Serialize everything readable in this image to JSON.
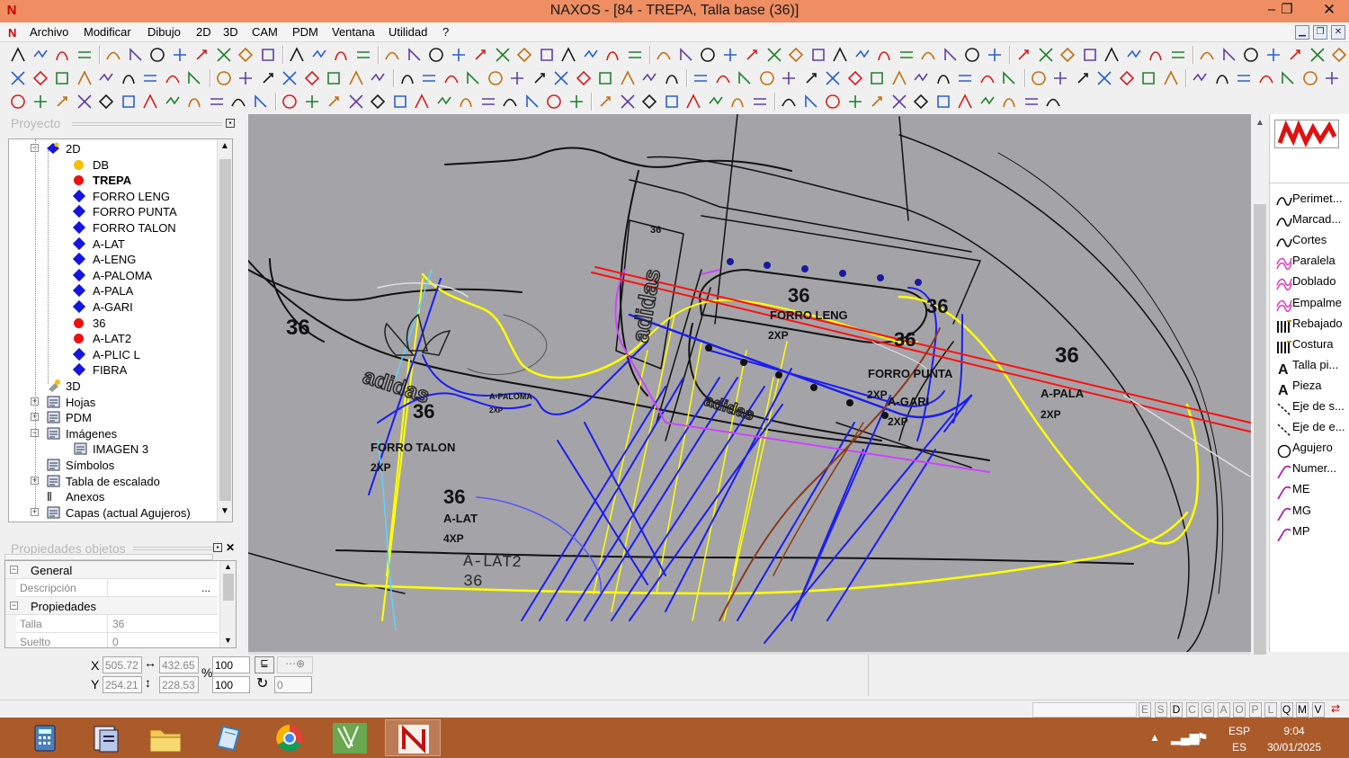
{
  "window": {
    "title": "NAXOS - [84 - TREPA, Talla base (36)]",
    "minimize": "‒",
    "restore": "❐",
    "close": "✕"
  },
  "menu": [
    "Archivo",
    "Modificar",
    "Dibujo",
    "2D",
    "3D",
    "CAM",
    "PDM",
    "Ventana",
    "Utilidad",
    "?"
  ],
  "project_panel": {
    "title": "Proyecto",
    "tree": [
      {
        "label": "2D",
        "kind": "folder2d",
        "level": 1,
        "expand": "−"
      },
      {
        "label": "DB",
        "kind": "dot-yellow",
        "level": 2
      },
      {
        "label": "TREPA",
        "kind": "dot-red",
        "level": 2,
        "bold": true
      },
      {
        "label": "FORRO LENG",
        "kind": "diamond",
        "level": 2
      },
      {
        "label": "FORRO PUNTA",
        "kind": "diamond",
        "level": 2
      },
      {
        "label": "FORRO TALON",
        "kind": "diamond",
        "level": 2
      },
      {
        "label": "A-LAT",
        "kind": "diamond",
        "level": 2
      },
      {
        "label": "A-LENG",
        "kind": "diamond",
        "level": 2
      },
      {
        "label": "A-PALOMA",
        "kind": "diamond",
        "level": 2
      },
      {
        "label": "A-PALA",
        "kind": "diamond",
        "level": 2
      },
      {
        "label": "A-GARI",
        "kind": "diamond",
        "level": 2
      },
      {
        "label": "36",
        "kind": "dot-red",
        "level": 2
      },
      {
        "label": "A-LAT2",
        "kind": "dot-red",
        "level": 2
      },
      {
        "label": "A-PLIC L",
        "kind": "diamond",
        "level": 2
      },
      {
        "label": "FIBRA",
        "kind": "diamond",
        "level": 2
      },
      {
        "label": "3D",
        "kind": "folder3d",
        "level": 1
      },
      {
        "label": "Hojas",
        "kind": "sheets",
        "level": 1,
        "expand": "+"
      },
      {
        "label": "PDM",
        "kind": "pdm",
        "level": 1,
        "expand": "+"
      },
      {
        "label": "Imágenes",
        "kind": "images",
        "level": 1,
        "expand": "−"
      },
      {
        "label": "IMAGEN 3",
        "kind": "image",
        "level": 2
      },
      {
        "label": "Símbolos",
        "kind": "symbols",
        "level": 1
      },
      {
        "label": "Tabla de escalado",
        "kind": "table",
        "level": 1,
        "expand": "+"
      },
      {
        "label": "Anexos",
        "kind": "clip",
        "level": 1
      },
      {
        "label": "Capas (actual Agujeros)",
        "kind": "layers",
        "level": 1,
        "expand": "+"
      }
    ]
  },
  "properties_panel": {
    "title": "Propiedades objetos",
    "rows": [
      {
        "type": "group",
        "label": "General"
      },
      {
        "type": "prop",
        "key": "Descripción",
        "value": "",
        "button": "..."
      },
      {
        "type": "group",
        "label": "Propiedades"
      },
      {
        "type": "prop",
        "key": "Talla",
        "value": "36"
      },
      {
        "type": "prop",
        "key": "Suelto",
        "value": "0"
      }
    ]
  },
  "canvas_labels": [
    {
      "text": "36",
      "cls": "big"
    },
    {
      "text": "36",
      "cls": "big"
    },
    {
      "text": "36",
      "cls": "big"
    },
    {
      "text": "36",
      "cls": "big"
    },
    {
      "text": "36",
      "cls": "big"
    },
    {
      "text": "36",
      "cls": "big"
    },
    {
      "text": "36",
      "cls": "big"
    },
    {
      "text": "FORRO LENG",
      "cls": "mid"
    },
    {
      "text": "2XP",
      "cls": "mid"
    },
    {
      "text": "FORRO PUNTA",
      "cls": "mid"
    },
    {
      "text": "2XP",
      "cls": "mid"
    },
    {
      "text": "A-GARI",
      "cls": "mid"
    },
    {
      "text": "2XP",
      "cls": "mid"
    },
    {
      "text": "A-PALA",
      "cls": "mid"
    },
    {
      "text": "2XP",
      "cls": "mid"
    },
    {
      "text": "FORRO TALON",
      "cls": "mid"
    },
    {
      "text": "2XP",
      "cls": "mid"
    },
    {
      "text": "A-PALOMA",
      "cls": "small"
    },
    {
      "text": "2XP",
      "cls": "small"
    },
    {
      "text": "A-LAT",
      "cls": "mid"
    },
    {
      "text": "4XP",
      "cls": "mid"
    },
    {
      "text": "A-LAT2",
      "cls": "thin"
    },
    {
      "text": "36",
      "cls": "thin"
    },
    {
      "text": "36",
      "cls": "tiny"
    },
    {
      "text": "adidas",
      "cls": "logo"
    },
    {
      "text": "adidas",
      "cls": "logo"
    },
    {
      "text": "adidas",
      "cls": "logo"
    }
  ],
  "right_tools": [
    {
      "label": "Perimet...",
      "icon": "curve"
    },
    {
      "label": "Marcad...",
      "icon": "curve"
    },
    {
      "label": "Cortes",
      "icon": "curve"
    },
    {
      "label": "Paralela",
      "icon": "parallel"
    },
    {
      "label": "Doblado",
      "icon": "parallel"
    },
    {
      "label": "Empalme",
      "icon": "parallel"
    },
    {
      "label": "Rebajado",
      "icon": "bars"
    },
    {
      "label": "Costura",
      "icon": "bars"
    },
    {
      "label": "Talla pi...",
      "icon": "letterA"
    },
    {
      "label": "Pieza",
      "icon": "letterA"
    },
    {
      "label": "Eje de s...",
      "icon": "dashed"
    },
    {
      "label": "Eje de e...",
      "icon": "dashed"
    },
    {
      "label": "Agujero",
      "icon": "circle"
    },
    {
      "label": "Numer...",
      "icon": "hook"
    },
    {
      "label": "ME",
      "icon": "hook"
    },
    {
      "label": "MG",
      "icon": "hook"
    },
    {
      "label": "MP",
      "icon": "hook"
    }
  ],
  "status": {
    "x_label": "X",
    "x": "505.72",
    "w": "432.65",
    "sx": "100",
    "y_label": "Y",
    "y": "254.21",
    "h": "228.53",
    "sy": "100",
    "rot": "0",
    "pct": "%",
    "letters": [
      "E",
      "S",
      "D",
      "C",
      "G",
      "A",
      "O",
      "P",
      "L",
      "Q",
      "M",
      "V"
    ]
  },
  "taskbar": {
    "lang": "ESP",
    "lang2": "ES",
    "time": "9:04",
    "date": "30/01/2025"
  }
}
